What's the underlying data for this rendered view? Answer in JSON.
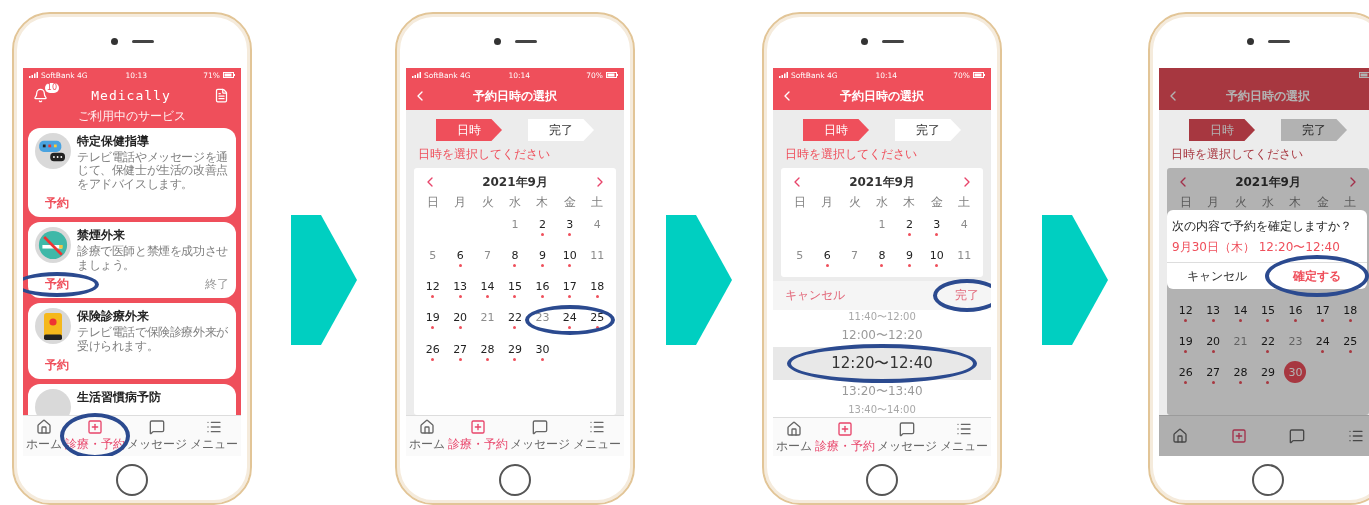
{
  "phones": [
    {
      "kind": "services",
      "status": {
        "carrier": "SoftBank 4G",
        "time": "10:13",
        "battery": "71%"
      },
      "header": {
        "title": "Medically",
        "badge": "10"
      },
      "section_label": "ご利用中のサービス",
      "cards": [
        {
          "title": "特定保健指導",
          "description": "テレビ電話やメッセージを通じて、保健士が生活の改善点をアドバイスします。",
          "action": "予約",
          "action_circled": false
        },
        {
          "title": "禁煙外来",
          "description": "診療で医師と禁煙を成功させましょう。",
          "action": "予約",
          "action_circled": true,
          "status": "終了"
        },
        {
          "title": "保険診療外来",
          "description": "テレビ電話で保険診療外来が受けられます。",
          "action": "予約",
          "action_circled": false
        },
        {
          "title": "生活習慣病予防"
        }
      ],
      "tabs": [
        {
          "label": "ホーム",
          "selected": false,
          "circled": false
        },
        {
          "label": "診療・予約",
          "selected": true,
          "circled": true
        },
        {
          "label": "メッセージ",
          "selected": false,
          "circled": false
        },
        {
          "label": "メニュー",
          "selected": false,
          "circled": false
        }
      ]
    },
    {
      "kind": "calendar",
      "status": {
        "carrier": "SoftBank 4G",
        "time": "10:14",
        "battery": "70%"
      },
      "header": {
        "title": "予約日時の選択"
      },
      "steps": [
        {
          "label": "日時",
          "selected": true
        },
        {
          "label": "完了",
          "selected": false
        }
      ],
      "hint": "日時を選択してください",
      "calendar": {
        "month": "2021年9月",
        "weekdays": [
          "日",
          "月",
          "火",
          "水",
          "木",
          "金",
          "土"
        ],
        "weeks": [
          [
            {
              "label": "1",
              "available": false,
              "selected": false,
              "circled": false
            },
            {
              "label": "2",
              "available": true,
              "selected": false,
              "circled": false
            },
            {
              "label": "3",
              "available": true,
              "selected": false,
              "circled": false
            },
            {
              "label": "4",
              "available": false,
              "selected": false,
              "circled": false
            }
          ],
          [
            {
              "label": "5",
              "available": false,
              "selected": false,
              "circled": false
            },
            {
              "label": "6",
              "available": true,
              "selected": false,
              "circled": false
            },
            {
              "label": "7",
              "available": false,
              "selected": false,
              "circled": false
            },
            {
              "label": "8",
              "available": true,
              "selected": false,
              "circled": false
            },
            {
              "label": "9",
              "available": true,
              "selected": false,
              "circled": false
            },
            {
              "label": "10",
              "available": true,
              "selected": false,
              "circled": false
            },
            {
              "label": "11",
              "available": false,
              "selected": false,
              "circled": false
            }
          ],
          [
            {
              "label": "12",
              "available": true,
              "selected": false,
              "circled": false
            },
            {
              "label": "13",
              "available": true,
              "selected": false,
              "circled": false
            },
            {
              "label": "14",
              "available": true,
              "selected": false,
              "circled": false
            },
            {
              "label": "15",
              "available": true,
              "selected": false,
              "circled": false
            },
            {
              "label": "16",
              "available": true,
              "selected": false,
              "circled": false
            },
            {
              "label": "17",
              "available": true,
              "selected": false,
              "circled": false
            },
            {
              "label": "18",
              "available": true,
              "selected": false,
              "circled": false
            }
          ],
          [
            {
              "label": "19",
              "available": true,
              "selected": false,
              "circled": false
            },
            {
              "label": "20",
              "available": true,
              "selected": false,
              "circled": false
            },
            {
              "label": "21",
              "available": false,
              "selected": false,
              "circled": false
            },
            {
              "label": "22",
              "available": true,
              "selected": false,
              "circled": false
            },
            {
              "label": "23",
              "available": false,
              "selected": false,
              "circled": true
            },
            {
              "label": "24",
              "available": true,
              "selected": false,
              "circled": true
            },
            {
              "label": "25",
              "available": true,
              "selected": false,
              "circled": true
            }
          ],
          [
            {
              "label": "26",
              "available": true,
              "selected": false,
              "circled": false
            },
            {
              "label": "27",
              "available": true,
              "selected": false,
              "circled": false
            },
            {
              "label": "28",
              "available": true,
              "selected": false,
              "circled": false
            },
            {
              "label": "29",
              "available": true,
              "selected": false,
              "circled": false
            },
            {
              "label": "30",
              "available": true,
              "selected": false,
              "circled": false
            }
          ]
        ]
      },
      "tabs": [
        {
          "label": "ホーム",
          "selected": false,
          "circled": false
        },
        {
          "label": "診療・予約",
          "selected": true,
          "circled": false
        },
        {
          "label": "メッセージ",
          "selected": false,
          "circled": false
        },
        {
          "label": "メニュー",
          "selected": false,
          "circled": false
        }
      ]
    },
    {
      "kind": "calendar",
      "status": {
        "carrier": "SoftBank 4G",
        "time": "10:14",
        "battery": "70%"
      },
      "header": {
        "title": "予約日時の選択"
      },
      "steps": [
        {
          "label": "日時",
          "selected": true
        },
        {
          "label": "完了",
          "selected": false
        }
      ],
      "hint": "日時を選択してください",
      "calendar": {
        "month": "2021年9月",
        "weekdays": [
          "日",
          "月",
          "火",
          "水",
          "木",
          "金",
          "土"
        ],
        "weeks": [
          [
            {
              "label": "1",
              "available": false,
              "selected": false,
              "circled": false
            },
            {
              "label": "2",
              "available": true,
              "selected": false,
              "circled": false
            },
            {
              "label": "3",
              "available": true,
              "selected": false,
              "circled": false
            },
            {
              "label": "4",
              "available": false,
              "selected": false,
              "circled": false
            }
          ],
          [
            {
              "label": "5",
              "available": false,
              "selected": false,
              "circled": false
            },
            {
              "label": "6",
              "available": true,
              "selected": false,
              "circled": false
            },
            {
              "label": "7",
              "available": false,
              "selected": false,
              "circled": false
            },
            {
              "label": "8",
              "available": true,
              "selected": false,
              "circled": false
            },
            {
              "label": "9",
              "available": true,
              "selected": false,
              "circled": false
            },
            {
              "label": "10",
              "available": true,
              "selected": false,
              "circled": false
            },
            {
              "label": "11",
              "available": false,
              "selected": false,
              "circled": false
            }
          ]
        ]
      },
      "picker": {
        "cancel": "キャンセル",
        "done": "完了",
        "done_circled": true,
        "times": [
          {
            "label": "11:40〜12:00",
            "selected": false,
            "circled": false
          },
          {
            "label": "12:00〜12:20",
            "selected": false,
            "circled": false
          },
          {
            "label": "12:20〜12:40",
            "selected": true,
            "circled": true
          },
          {
            "label": "13:20〜13:40",
            "selected": false,
            "circled": false
          },
          {
            "label": "13:40〜14:00",
            "selected": false,
            "circled": false
          }
        ]
      },
      "tabs": [
        {
          "label": "ホーム",
          "selected": false,
          "circled": false
        },
        {
          "label": "診療・予約",
          "selected": true,
          "circled": false
        },
        {
          "label": "メッセージ",
          "selected": false,
          "circled": false
        },
        {
          "label": "メニュー",
          "selected": false,
          "circled": false
        }
      ]
    },
    {
      "kind": "calendar",
      "dimmed": true,
      "header": {
        "title": "予約日時の選択"
      },
      "steps": [
        {
          "label": "日時",
          "selected": true
        },
        {
          "label": "完了",
          "selected": false
        }
      ],
      "hint": "日時を選択してください",
      "calendar": {
        "month": "2021年9月",
        "weekdays": [
          "日",
          "月",
          "火",
          "水",
          "木",
          "金",
          "土"
        ],
        "weeks": [
          [
            {
              "label": "12",
              "available": true,
              "selected": false,
              "circled": false
            },
            {
              "label": "13",
              "available": true,
              "selected": false,
              "circled": false
            },
            {
              "label": "14",
              "available": true,
              "selected": false,
              "circled": false
            },
            {
              "label": "15",
              "available": true,
              "selected": false,
              "circled": false
            },
            {
              "label": "16",
              "available": true,
              "selected": false,
              "circled": false
            },
            {
              "label": "17",
              "available": true,
              "selected": false,
              "circled": false
            },
            {
              "label": "18",
              "available": true,
              "selected": false,
              "circled": false
            }
          ],
          [
            {
              "label": "19",
              "available": true,
              "selected": false,
              "circled": false
            },
            {
              "label": "20",
              "available": true,
              "selected": false,
              "circled": false
            },
            {
              "label": "21",
              "available": false,
              "selected": false,
              "circled": false
            },
            {
              "label": "22",
              "available": true,
              "selected": false,
              "circled": false
            },
            {
              "label": "23",
              "available": false,
              "selected": false,
              "circled": false
            },
            {
              "label": "24",
              "available": true,
              "selected": false,
              "circled": false
            },
            {
              "label": "25",
              "available": true,
              "selected": false,
              "circled": false
            }
          ],
          [
            {
              "label": "26",
              "available": true,
              "selected": false,
              "circled": false
            },
            {
              "label": "27",
              "available": true,
              "selected": false,
              "circled": false
            },
            {
              "label": "28",
              "available": true,
              "selected": false,
              "circled": false
            },
            {
              "label": "29",
              "available": true,
              "selected": false,
              "circled": false
            },
            {
              "label": "30",
              "available": true,
              "selected": true,
              "circled": false
            }
          ]
        ]
      },
      "dialog": {
        "message": "次の内容で予約を確定しますか？",
        "detail": "9月30日（木） 12:20〜12:40",
        "buttons": [
          {
            "label": "キャンセル",
            "kind": "cancel",
            "circled": false
          },
          {
            "label": "確定する",
            "kind": "confirm",
            "circled": true
          }
        ]
      },
      "tabs": [
        {
          "selected": false,
          "circled": false
        },
        {
          "selected": true,
          "circled": false
        },
        {
          "selected": false,
          "circled": false
        },
        {
          "selected": false,
          "circled": false
        }
      ]
    }
  ]
}
